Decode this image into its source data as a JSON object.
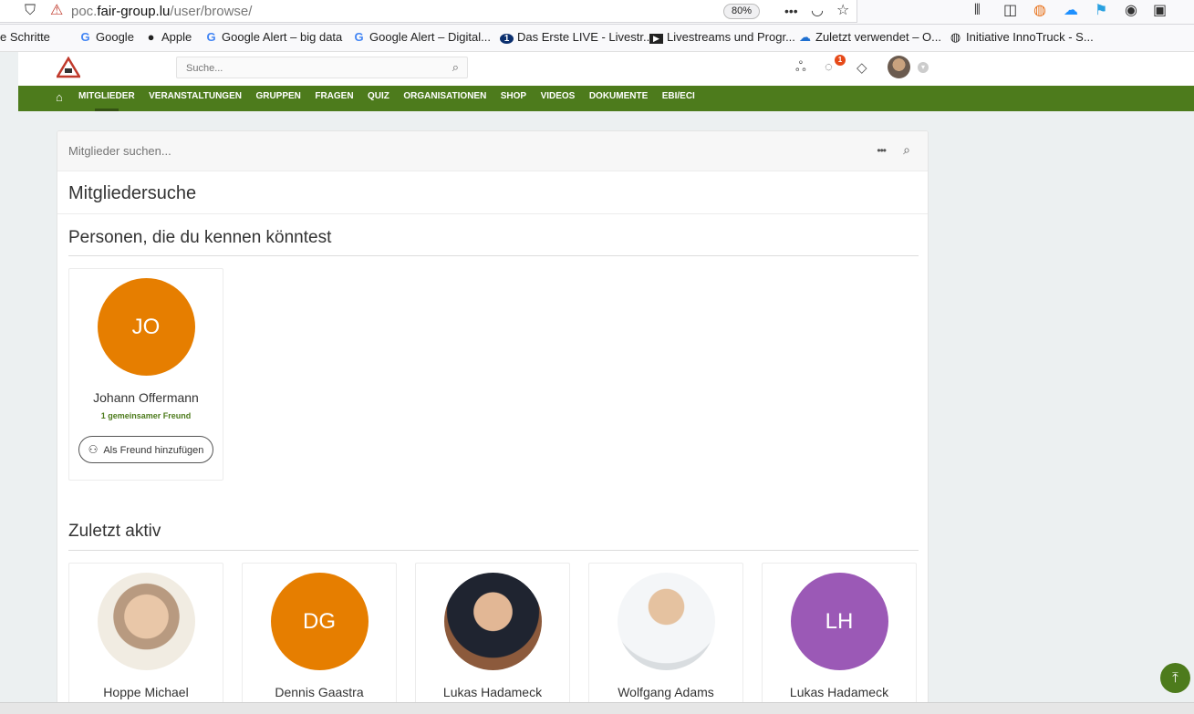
{
  "browser": {
    "url_prefix": "poc.",
    "url_domain": "fair-group.lu",
    "url_path": "/user/browse/",
    "zoom": "80%",
    "bookmarks": [
      {
        "label": "e Schritte",
        "icon": ""
      },
      {
        "label": "Google",
        "icon": "G"
      },
      {
        "label": "Apple",
        "icon": ""
      },
      {
        "label": "Google Alert – big data",
        "icon": "G"
      },
      {
        "label": "Google Alert – Digital...",
        "icon": "G"
      },
      {
        "label": "Das Erste LIVE - Livestr...",
        "icon": "1"
      },
      {
        "label": "Livestreams und Progr...",
        "icon": "▶"
      },
      {
        "label": "Zuletzt verwendet – O...",
        "icon": "☁"
      },
      {
        "label": "Initiative InnoTruck - S...",
        "icon": "◍"
      }
    ]
  },
  "header": {
    "search_placeholder": "Suche...",
    "notification_count": "1"
  },
  "nav": {
    "items": [
      "MITGLIEDER",
      "VERANSTALTUNGEN",
      "GRUPPEN",
      "FRAGEN",
      "QUIZ",
      "ORGANISATIONEN",
      "SHOP",
      "VIDEOS",
      "DOKUMENTE",
      "EBI/ECI"
    ]
  },
  "main": {
    "member_search_placeholder": "Mitglieder suchen...",
    "title": "Mitgliedersuche",
    "suggest_heading": "Personen, die du kennen könntest",
    "suggestion": {
      "initials": "JO",
      "name": "Johann Offermann",
      "mutual": "1 gemeinsamer Freund",
      "add_label": "Als Freund hinzufügen",
      "color": "#e67e00"
    },
    "recent_heading": "Zuletzt aktiv",
    "recent": [
      {
        "name": "Hoppe Michael",
        "initials": "",
        "kind": "photo"
      },
      {
        "name": "Dennis Gaastra",
        "initials": "DG",
        "kind": "initials",
        "color": "#e67e00"
      },
      {
        "name": "Lukas Hadameck",
        "initials": "",
        "kind": "photo"
      },
      {
        "name": "Wolfgang Adams",
        "initials": "",
        "kind": "photo"
      },
      {
        "name": "Lukas Hadameck",
        "initials": "LH",
        "kind": "initials",
        "color": "#9b59b6"
      }
    ]
  }
}
